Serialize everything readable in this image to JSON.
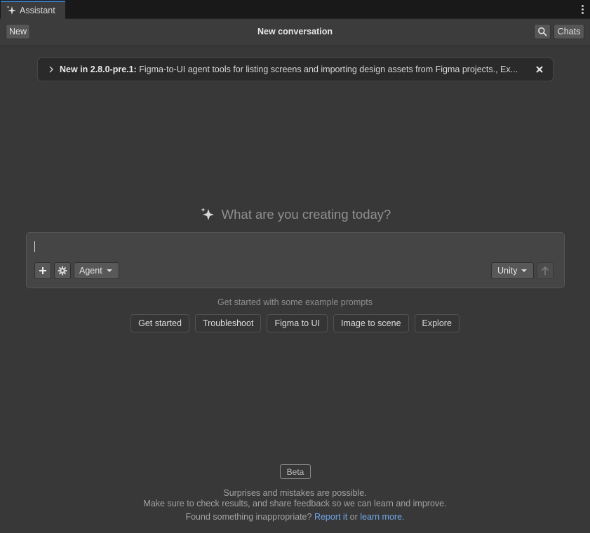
{
  "tab": {
    "label": "Assistant"
  },
  "toolbar": {
    "new_label": "New",
    "title": "New conversation",
    "chats_label": "Chats"
  },
  "banner": {
    "version_label": "New in 2.8.0-pre.1:",
    "message": " Figma-to-UI agent tools for listing screens and importing design assets from Figma projects., Ex..."
  },
  "heading": {
    "text": "What are you creating today?"
  },
  "prompt": {
    "value": "",
    "mode_label": "Agent",
    "context_label": "Unity"
  },
  "examples": {
    "label": "Get started with some example prompts",
    "items": [
      "Get started",
      "Troubleshoot",
      "Figma to UI",
      "Image to scene",
      "Explore"
    ]
  },
  "footer": {
    "badge": "Beta",
    "line1": "Surprises and mistakes are possible.",
    "line2": "Make sure to check results, and share feedback so we can learn and improve.",
    "line3_prefix": "Found something inappropriate?",
    "report_link": "Report it",
    "or_text": "or",
    "learn_link": "learn more",
    "period": "."
  },
  "colors": {
    "accent": "#3a79bb",
    "link": "#6fa6e8",
    "background": "#383838"
  }
}
